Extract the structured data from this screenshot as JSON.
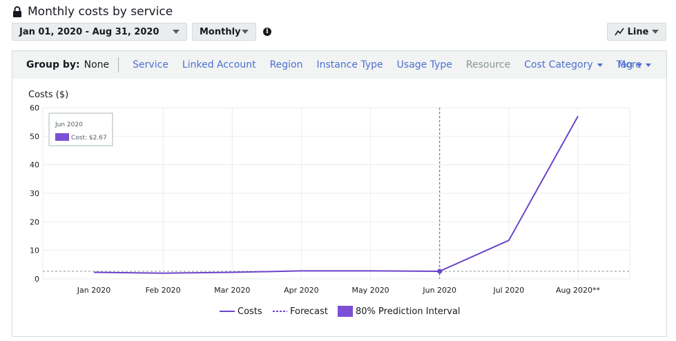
{
  "page_title": "Monthly costs by service",
  "controls": {
    "date_range": "Jan 01, 2020 - Aug 31, 2020",
    "granularity": "Monthly",
    "info": "i",
    "chart_type": "Line"
  },
  "groupby": {
    "label": "Group by:",
    "value": "None",
    "options": [
      "Service",
      "Linked Account",
      "Region",
      "Instance Type",
      "Usage Type"
    ],
    "resource": "Resource",
    "cost_category": "Cost Category",
    "tag": "Tag",
    "more": "More"
  },
  "colors": {
    "series": "#6b43c9",
    "prediction": "#7b4fd6",
    "grid": "#eaeded",
    "link": "#4b6fd0"
  },
  "chart_data": {
    "type": "line",
    "ylabel": "Costs ($)",
    "ylim": [
      0,
      60
    ],
    "yticks": [
      0,
      10,
      20,
      30,
      40,
      50,
      60
    ],
    "categories": [
      "Jan 2020",
      "Feb 2020",
      "Mar 2020",
      "Apr 2020",
      "May 2020",
      "Jun 2020",
      "Jul 2020",
      "Aug 2020**"
    ],
    "series": [
      {
        "name": "Costs",
        "values": [
          2.3,
          2.0,
          2.3,
          2.8,
          2.8,
          2.67,
          null,
          null
        ]
      },
      {
        "name": "Forecast",
        "values": [
          null,
          null,
          null,
          null,
          null,
          2.67,
          13.5,
          57
        ]
      }
    ],
    "reference_line": 2.67,
    "highlight_category": "Jun 2020",
    "tooltip": {
      "title": "Jun 2020",
      "label": "Cost: $2.67"
    },
    "legend": [
      "Costs",
      "Forecast",
      "80% Prediction Interval"
    ],
    "grid": true,
    "legend_position": "bottom"
  }
}
